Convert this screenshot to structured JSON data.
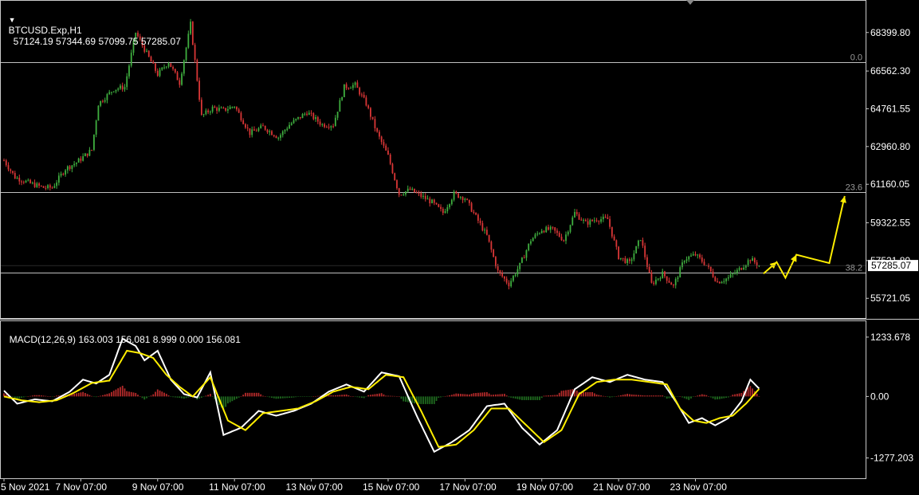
{
  "header": {
    "symbol_tf": "BTCUSD.Exp,H1",
    "ohlc": "57124.19 57344.69 57099.75 57285.07",
    "macd_text": "MACD(12,26,9) 163.003 156.081 8.999 0.000 156.081"
  },
  "current_price_label": "57285.07",
  "colors": {
    "bg": "#000000",
    "frame": "#c8c8c8",
    "bull": "#3fae3f",
    "bear": "#d93636",
    "fib": "#bfbfbf",
    "arrow": "#ffee00",
    "macd_line": "#ffffff",
    "signal_line": "#ffee00",
    "hist_pos": "#b42a2a",
    "hist_neg": "#1f6a1f"
  },
  "chart_data": [
    {
      "type": "candlestick",
      "title": "BTCUSD.Exp,H1",
      "price_ticks": [
        "68399.80",
        "66562.30",
        "64761.55",
        "62960.80",
        "61160.05",
        "59322.55",
        "57521.80",
        "55721.05"
      ],
      "time_ticks": [
        "5 Nov 2021",
        "7 Nov 07:00",
        "9 Nov 07:00",
        "11 Nov 07:00",
        "13 Nov 07:00",
        "15 Nov 07:00",
        "17 Nov 07:00",
        "19 Nov 07:00",
        "21 Nov 07:00",
        "23 Nov 07:00"
      ],
      "ylim": [
        54780,
        69950
      ],
      "close_path": [
        {
          "bar": 0,
          "price": 62300
        },
        {
          "bar": 5,
          "price": 61500
        },
        {
          "bar": 12,
          "price": 61200
        },
        {
          "bar": 18,
          "price": 61000
        },
        {
          "bar": 22,
          "price": 61000
        },
        {
          "bar": 28,
          "price": 61900
        },
        {
          "bar": 33,
          "price": 62200
        },
        {
          "bar": 40,
          "price": 62800
        },
        {
          "bar": 43,
          "price": 65000
        },
        {
          "bar": 50,
          "price": 65700
        },
        {
          "bar": 55,
          "price": 65800
        },
        {
          "bar": 60,
          "price": 68400
        },
        {
          "bar": 65,
          "price": 67400
        },
        {
          "bar": 70,
          "price": 66400
        },
        {
          "bar": 75,
          "price": 67000
        },
        {
          "bar": 80,
          "price": 66000
        },
        {
          "bar": 85,
          "price": 68800
        },
        {
          "bar": 90,
          "price": 64400
        },
        {
          "bar": 95,
          "price": 64800
        },
        {
          "bar": 100,
          "price": 64700
        },
        {
          "bar": 105,
          "price": 64900
        },
        {
          "bar": 112,
          "price": 63600
        },
        {
          "bar": 118,
          "price": 63900
        },
        {
          "bar": 125,
          "price": 63400
        },
        {
          "bar": 130,
          "price": 64000
        },
        {
          "bar": 138,
          "price": 64600
        },
        {
          "bar": 145,
          "price": 64000
        },
        {
          "bar": 150,
          "price": 64000
        },
        {
          "bar": 155,
          "price": 65800
        },
        {
          "bar": 160,
          "price": 65900
        },
        {
          "bar": 165,
          "price": 65000
        },
        {
          "bar": 170,
          "price": 63600
        },
        {
          "bar": 175,
          "price": 62500
        },
        {
          "bar": 180,
          "price": 60700
        },
        {
          "bar": 185,
          "price": 60900
        },
        {
          "bar": 190,
          "price": 60600
        },
        {
          "bar": 195,
          "price": 60300
        },
        {
          "bar": 200,
          "price": 59800
        },
        {
          "bar": 205,
          "price": 60700
        },
        {
          "bar": 210,
          "price": 60500
        },
        {
          "bar": 215,
          "price": 59600
        },
        {
          "bar": 220,
          "price": 58700
        },
        {
          "bar": 225,
          "price": 57000
        },
        {
          "bar": 230,
          "price": 56400
        },
        {
          "bar": 235,
          "price": 57300
        },
        {
          "bar": 240,
          "price": 58500
        },
        {
          "bar": 245,
          "price": 59000
        },
        {
          "bar": 250,
          "price": 59000
        },
        {
          "bar": 255,
          "price": 58500
        },
        {
          "bar": 260,
          "price": 59800
        },
        {
          "bar": 265,
          "price": 59300
        },
        {
          "bar": 270,
          "price": 59500
        },
        {
          "bar": 275,
          "price": 59500
        },
        {
          "bar": 280,
          "price": 57700
        },
        {
          "bar": 285,
          "price": 57400
        },
        {
          "bar": 290,
          "price": 58600
        },
        {
          "bar": 295,
          "price": 56400
        },
        {
          "bar": 300,
          "price": 56900
        },
        {
          "bar": 305,
          "price": 56300
        },
        {
          "bar": 310,
          "price": 57600
        },
        {
          "bar": 315,
          "price": 57800
        },
        {
          "bar": 320,
          "price": 57300
        },
        {
          "bar": 325,
          "price": 56500
        },
        {
          "bar": 330,
          "price": 56700
        },
        {
          "bar": 335,
          "price": 57100
        },
        {
          "bar": 340,
          "price": 57600
        },
        {
          "bar": 344,
          "price": 57285
        }
      ],
      "fib_levels": [
        {
          "label": "0.0",
          "price": 67000
        },
        {
          "label": "23.6",
          "price": 60800
        },
        {
          "label": "38.2",
          "price": 56950
        }
      ],
      "projection_arrow": [
        {
          "bar": 346,
          "price": 56900
        },
        {
          "bar": 352,
          "price": 57450
        },
        {
          "bar": 356,
          "price": 56700
        },
        {
          "bar": 361,
          "price": 57800
        },
        {
          "bar": 376,
          "price": 57400
        },
        {
          "bar": 383,
          "price": 60600
        }
      ]
    },
    {
      "type": "line",
      "title": "MACD(12,26,9)",
      "ylabel_ticks": [
        "1233.678",
        "0.00",
        "-1277.203"
      ],
      "ylim": [
        -1700,
        1580
      ],
      "series": [
        {
          "name": "MACD(12,26,9)",
          "points": [
            {
              "bar": 0,
              "value": 120
            },
            {
              "bar": 6,
              "value": -150
            },
            {
              "bar": 14,
              "value": -60
            },
            {
              "bar": 22,
              "value": -100
            },
            {
              "bar": 30,
              "value": 100
            },
            {
              "bar": 36,
              "value": 350
            },
            {
              "bar": 42,
              "value": 270
            },
            {
              "bar": 48,
              "value": 450
            },
            {
              "bar": 54,
              "value": 1200
            },
            {
              "bar": 60,
              "value": 1050
            },
            {
              "bar": 64,
              "value": 750
            },
            {
              "bar": 70,
              "value": 950
            },
            {
              "bar": 76,
              "value": 350
            },
            {
              "bar": 82,
              "value": 50
            },
            {
              "bar": 88,
              "value": -20
            },
            {
              "bar": 94,
              "value": 500
            },
            {
              "bar": 100,
              "value": -800
            },
            {
              "bar": 108,
              "value": -650
            },
            {
              "bar": 116,
              "value": -300
            },
            {
              "bar": 124,
              "value": -400
            },
            {
              "bar": 132,
              "value": -300
            },
            {
              "bar": 140,
              "value": -150
            },
            {
              "bar": 148,
              "value": 100
            },
            {
              "bar": 156,
              "value": 250
            },
            {
              "bar": 164,
              "value": 100
            },
            {
              "bar": 172,
              "value": 500
            },
            {
              "bar": 180,
              "value": 420
            },
            {
              "bar": 188,
              "value": -400
            },
            {
              "bar": 196,
              "value": -1150
            },
            {
              "bar": 204,
              "value": -950
            },
            {
              "bar": 212,
              "value": -700
            },
            {
              "bar": 220,
              "value": -200
            },
            {
              "bar": 228,
              "value": -150
            },
            {
              "bar": 236,
              "value": -650
            },
            {
              "bar": 244,
              "value": -1000
            },
            {
              "bar": 252,
              "value": -700
            },
            {
              "bar": 260,
              "value": 150
            },
            {
              "bar": 268,
              "value": 400
            },
            {
              "bar": 276,
              "value": 300
            },
            {
              "bar": 284,
              "value": 450
            },
            {
              "bar": 292,
              "value": 350
            },
            {
              "bar": 300,
              "value": 300
            },
            {
              "bar": 306,
              "value": -100
            },
            {
              "bar": 312,
              "value": -550
            },
            {
              "bar": 318,
              "value": -450
            },
            {
              "bar": 324,
              "value": -600
            },
            {
              "bar": 330,
              "value": -450
            },
            {
              "bar": 336,
              "value": -100
            },
            {
              "bar": 340,
              "value": 350
            },
            {
              "bar": 344,
              "value": 163
            }
          ]
        },
        {
          "name": "Signal",
          "points": [
            {
              "bar": 0,
              "value": 0
            },
            {
              "bar": 8,
              "value": -80
            },
            {
              "bar": 16,
              "value": -120
            },
            {
              "bar": 24,
              "value": -80
            },
            {
              "bar": 32,
              "value": 80
            },
            {
              "bar": 40,
              "value": 280
            },
            {
              "bar": 48,
              "value": 330
            },
            {
              "bar": 56,
              "value": 950
            },
            {
              "bar": 62,
              "value": 900
            },
            {
              "bar": 68,
              "value": 800
            },
            {
              "bar": 74,
              "value": 450
            },
            {
              "bar": 80,
              "value": 200
            },
            {
              "bar": 86,
              "value": 0
            },
            {
              "bar": 94,
              "value": 400
            },
            {
              "bar": 102,
              "value": -500
            },
            {
              "bar": 110,
              "value": -700
            },
            {
              "bar": 118,
              "value": -350
            },
            {
              "bar": 126,
              "value": -300
            },
            {
              "bar": 134,
              "value": -250
            },
            {
              "bar": 142,
              "value": -100
            },
            {
              "bar": 150,
              "value": 100
            },
            {
              "bar": 158,
              "value": 200
            },
            {
              "bar": 166,
              "value": 150
            },
            {
              "bar": 174,
              "value": 450
            },
            {
              "bar": 182,
              "value": 400
            },
            {
              "bar": 190,
              "value": -300
            },
            {
              "bar": 198,
              "value": -1050
            },
            {
              "bar": 206,
              "value": -1000
            },
            {
              "bar": 214,
              "value": -700
            },
            {
              "bar": 222,
              "value": -250
            },
            {
              "bar": 230,
              "value": -250
            },
            {
              "bar": 238,
              "value": -600
            },
            {
              "bar": 246,
              "value": -950
            },
            {
              "bar": 254,
              "value": -700
            },
            {
              "bar": 262,
              "value": 50
            },
            {
              "bar": 270,
              "value": 300
            },
            {
              "bar": 278,
              "value": 350
            },
            {
              "bar": 286,
              "value": 350
            },
            {
              "bar": 294,
              "value": 300
            },
            {
              "bar": 302,
              "value": 250
            },
            {
              "bar": 308,
              "value": -250
            },
            {
              "bar": 314,
              "value": -500
            },
            {
              "bar": 320,
              "value": -550
            },
            {
              "bar": 326,
              "value": -450
            },
            {
              "bar": 332,
              "value": -400
            },
            {
              "bar": 338,
              "value": -150
            },
            {
              "bar": 344,
              "value": 156
            }
          ]
        }
      ]
    }
  ]
}
